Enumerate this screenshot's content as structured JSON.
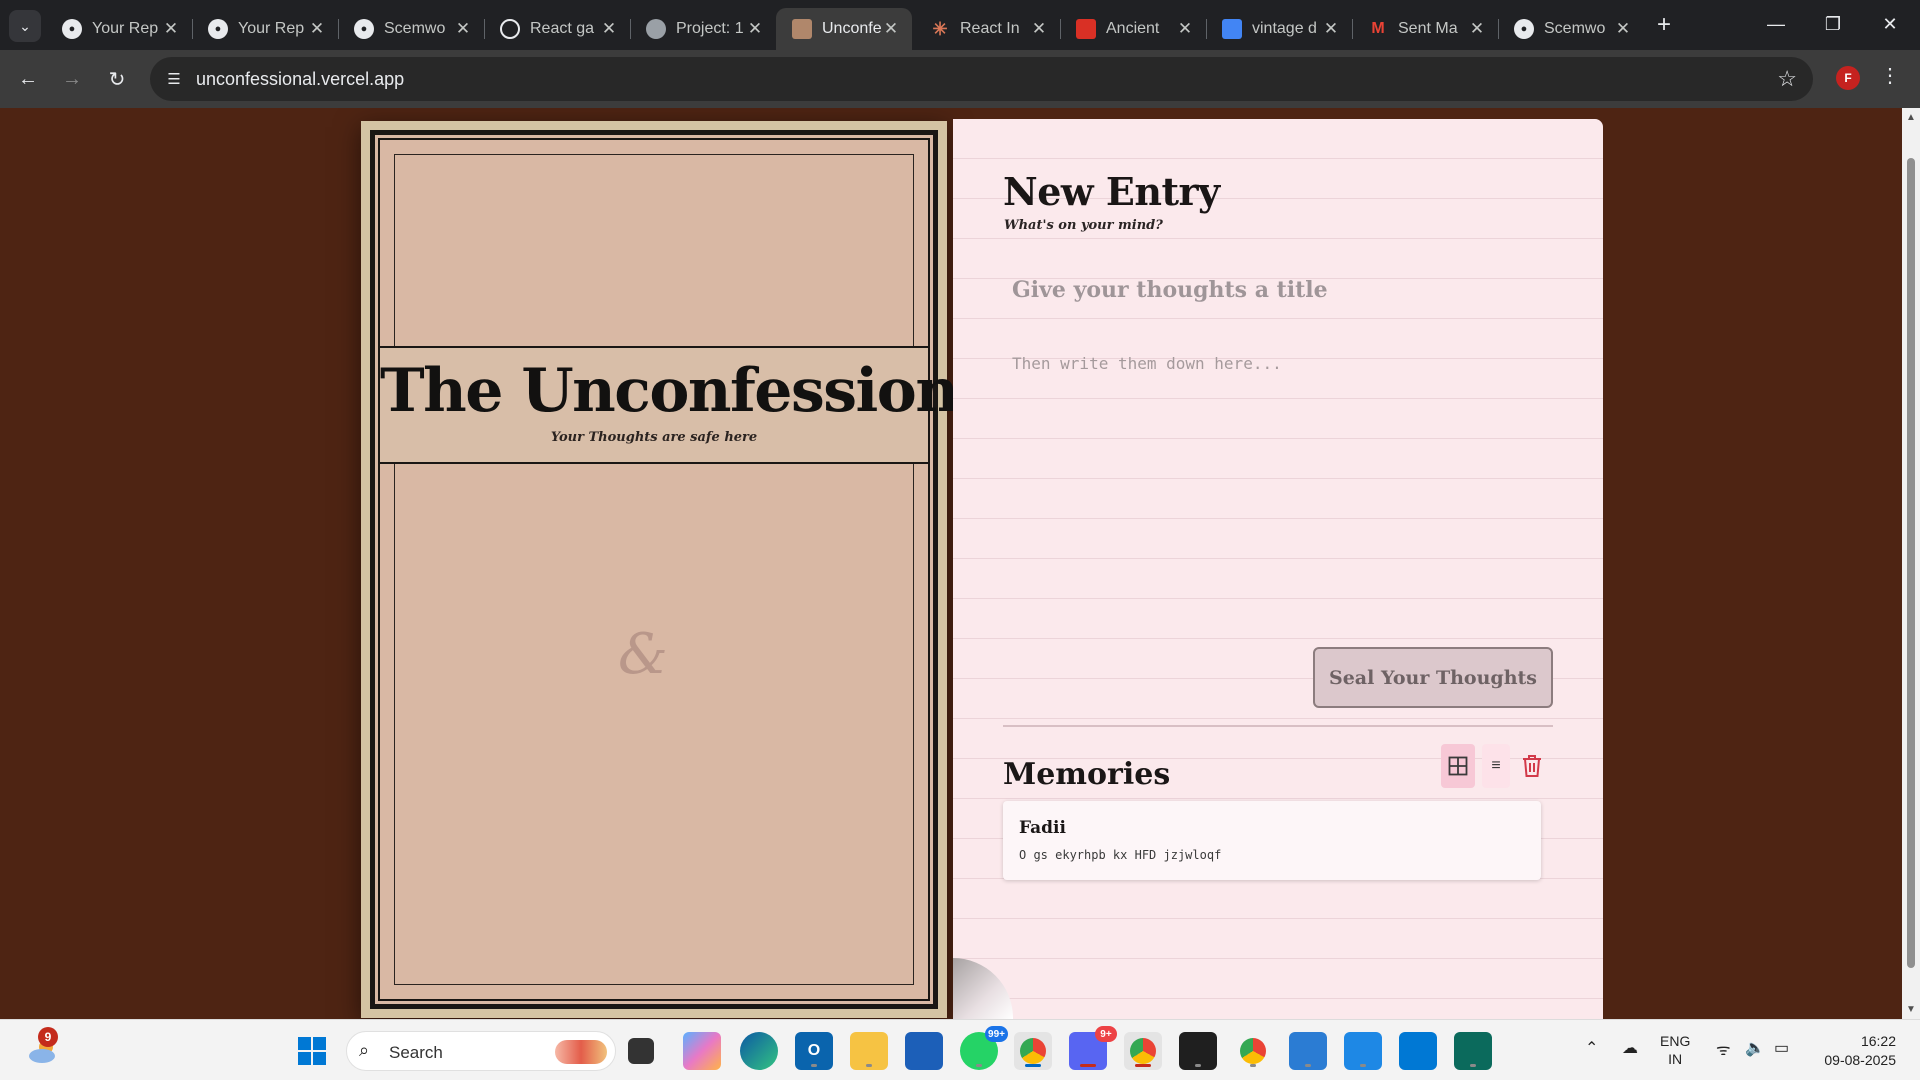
{
  "browser": {
    "tabs": [
      {
        "title": "Your Rep",
        "icon": "github-icon",
        "color": "#e8eaed"
      },
      {
        "title": "Your Rep",
        "icon": "github-icon",
        "color": "#e8eaed"
      },
      {
        "title": "Scemwo",
        "icon": "github-icon",
        "color": "#e8eaed"
      },
      {
        "title": "React ga",
        "icon": "openai-icon",
        "color": "#e8eaed"
      },
      {
        "title": "Project: 1",
        "icon": "globe-icon",
        "color": "#9aa0a6"
      },
      {
        "title": "Unconfe",
        "icon": "book-icon",
        "color": "#b0876b",
        "active": true
      },
      {
        "title": "React In",
        "icon": "asterisk-icon",
        "color": "#d97757"
      },
      {
        "title": "Ancient",
        "icon": "book-red-icon",
        "color": "#d93025"
      },
      {
        "title": "vintage d",
        "icon": "docs-icon",
        "color": "#4285f4"
      },
      {
        "title": "Sent Ma",
        "icon": "gmail-icon",
        "color": "#ea4335"
      },
      {
        "title": "Scemwo",
        "icon": "github-icon",
        "color": "#e8eaed"
      }
    ],
    "url": "unconfessional.vercel.app",
    "profile_initial": "F"
  },
  "cover": {
    "title": "The Unconfessional",
    "subtitle": "Your Thoughts are safe here",
    "ornament": "&"
  },
  "journal": {
    "heading": "New Entry",
    "subheading": "What's on your mind?",
    "title_placeholder": "Give your thoughts a title",
    "body_placeholder": "Then write them down here...",
    "seal_button": "Seal Your Thoughts",
    "memories_heading": "Memories",
    "memories": [
      {
        "title": "Fadii",
        "text": "O gs ekyrhpb kx HFD jzjwloqf"
      }
    ]
  },
  "taskbar": {
    "weather_badge": "9",
    "search_label": "Search",
    "whatsapp_badge": "99+",
    "discord_badge": "9+",
    "lang_line1": "ENG",
    "lang_line2": "IN",
    "time": "16:22",
    "date": "09-08-2025"
  },
  "colors": {
    "page_background": "#4e2413",
    "cover": "#d9b8a4",
    "journal_paper": "#fbe9ec",
    "accent_delete": "#d23a4a"
  }
}
